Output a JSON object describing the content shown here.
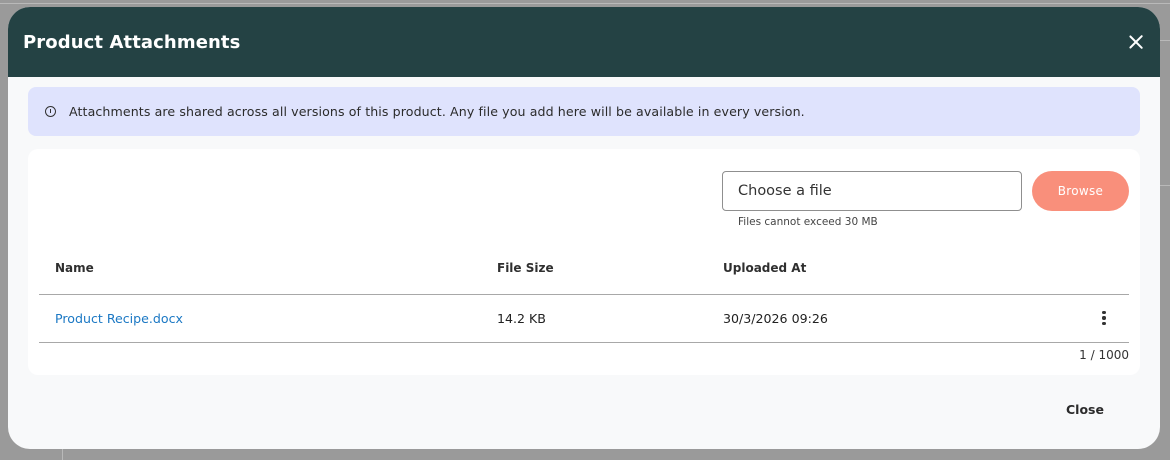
{
  "modal": {
    "title": "Product Attachments",
    "close_icon": "close-icon",
    "header_color": "#244244"
  },
  "info": {
    "icon": "info-circle-icon",
    "text": "Attachments are shared across all versions of this product. Any file you add here will be available in every version."
  },
  "upload": {
    "placeholder": "Choose a file",
    "hint": "Files cannot exceed 30 MB",
    "browse_label": "Browse",
    "browse_color": "#f98f7b"
  },
  "table": {
    "columns": [
      "Name",
      "File Size",
      "Uploaded At"
    ],
    "rows": [
      {
        "name": "Product Recipe.docx",
        "size": "14.2 KB",
        "uploaded": "30/3/2026 09:26",
        "actions_icon": "more-vertical-icon"
      }
    ],
    "pagination": "1 / 1000"
  },
  "footer": {
    "close_label": "Close"
  }
}
